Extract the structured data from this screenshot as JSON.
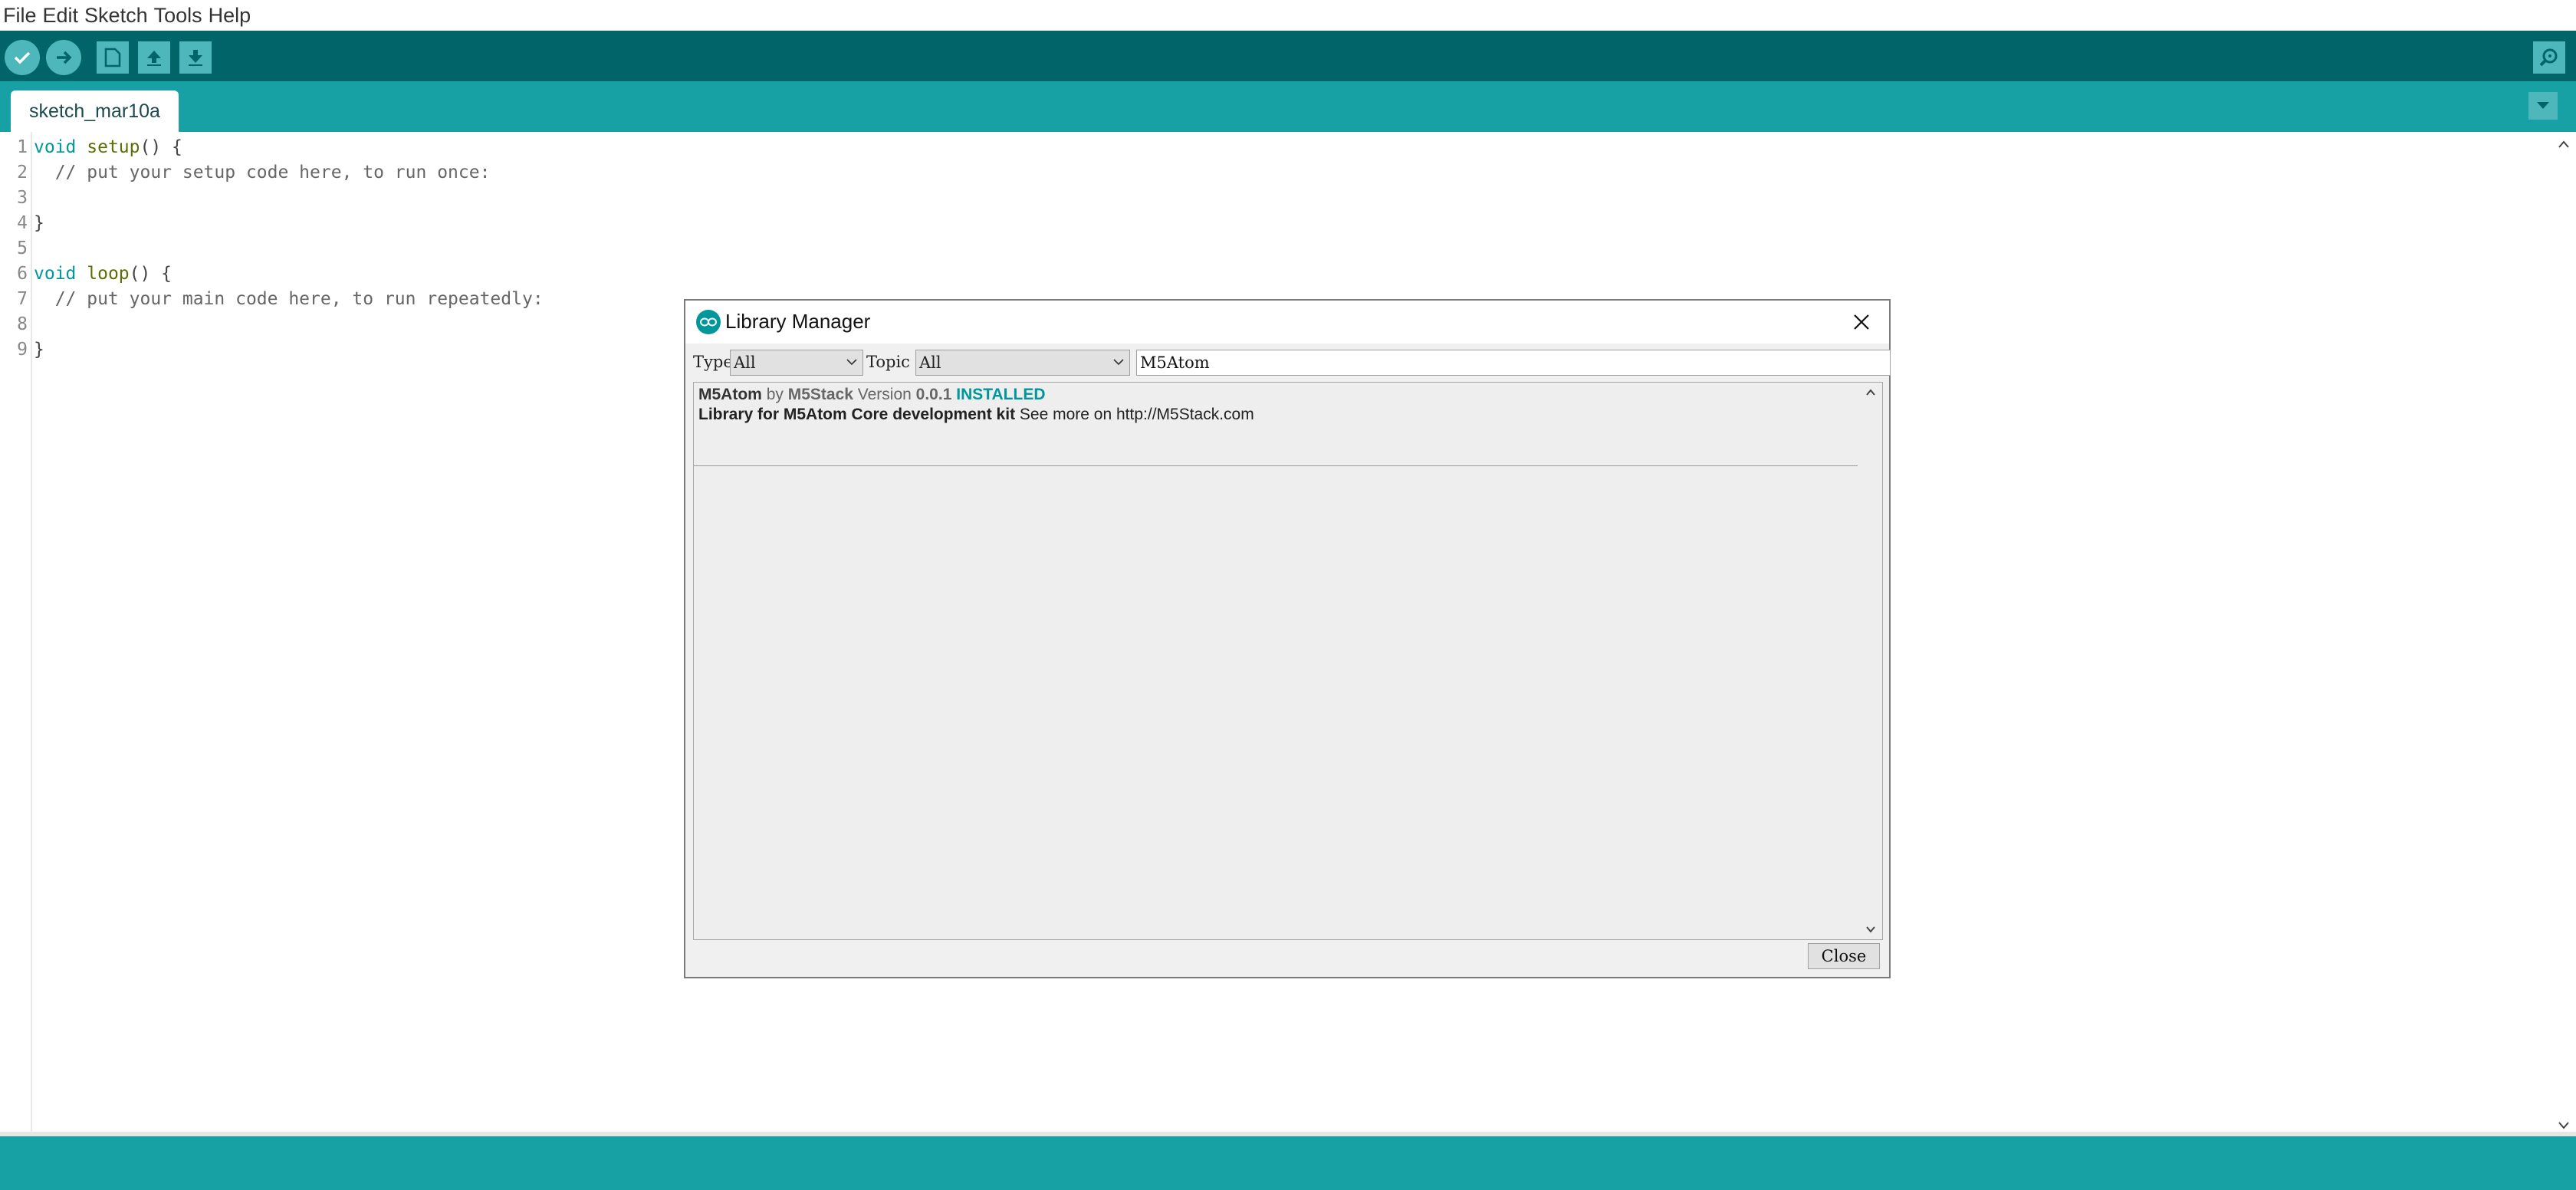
{
  "menubar": {
    "items": [
      "File",
      "Edit",
      "Sketch",
      "Tools",
      "Help"
    ]
  },
  "toolbar": {
    "buttons": [
      {
        "icon": "verify-icon"
      },
      {
        "icon": "upload-icon"
      },
      {
        "icon": "new-icon"
      },
      {
        "icon": "open-icon"
      },
      {
        "icon": "save-icon"
      },
      {
        "icon": "serial-monitor-icon"
      }
    ]
  },
  "tabs": {
    "active": "sketch_mar10a"
  },
  "editor": {
    "line_numbers": [
      "1",
      "2",
      "3",
      "4",
      "5",
      "6",
      "7",
      "8",
      "9"
    ],
    "lines": [
      {
        "parts": [
          {
            "t": "void",
            "c": "kw"
          },
          {
            "t": " "
          },
          {
            "t": "setup",
            "c": "fn"
          },
          {
            "t": "() {"
          }
        ]
      },
      {
        "parts": [
          {
            "t": "  // put your setup code here, to run once:",
            "c": "cm"
          }
        ]
      },
      {
        "parts": []
      },
      {
        "parts": [
          {
            "t": "}"
          }
        ]
      },
      {
        "parts": []
      },
      {
        "parts": [
          {
            "t": "void",
            "c": "kw"
          },
          {
            "t": " "
          },
          {
            "t": "loop",
            "c": "fn"
          },
          {
            "t": "() {"
          }
        ]
      },
      {
        "parts": [
          {
            "t": "  // put your main code here, to run repeatedly:",
            "c": "cm"
          }
        ]
      },
      {
        "parts": []
      },
      {
        "parts": [
          {
            "t": "}"
          }
        ]
      }
    ]
  },
  "dialog": {
    "title": "Library Manager",
    "type_label": "Type",
    "type_value": "All",
    "topic_label": "Topic",
    "topic_value": "All",
    "search_value": "M5Atom",
    "library": {
      "name": "M5Atom",
      "by": "by",
      "author": "M5Stack",
      "version_label": "Version",
      "version": "0.0.1",
      "status": "INSTALLED",
      "description": "Library for M5Atom Core development kit",
      "more": "See more on http://M5Stack.com"
    },
    "close_label": "Close"
  },
  "colors": {
    "toolbar": "#006468",
    "tabbar": "#17a1a5",
    "accent": "#00979c",
    "button": "#4db7bb"
  }
}
